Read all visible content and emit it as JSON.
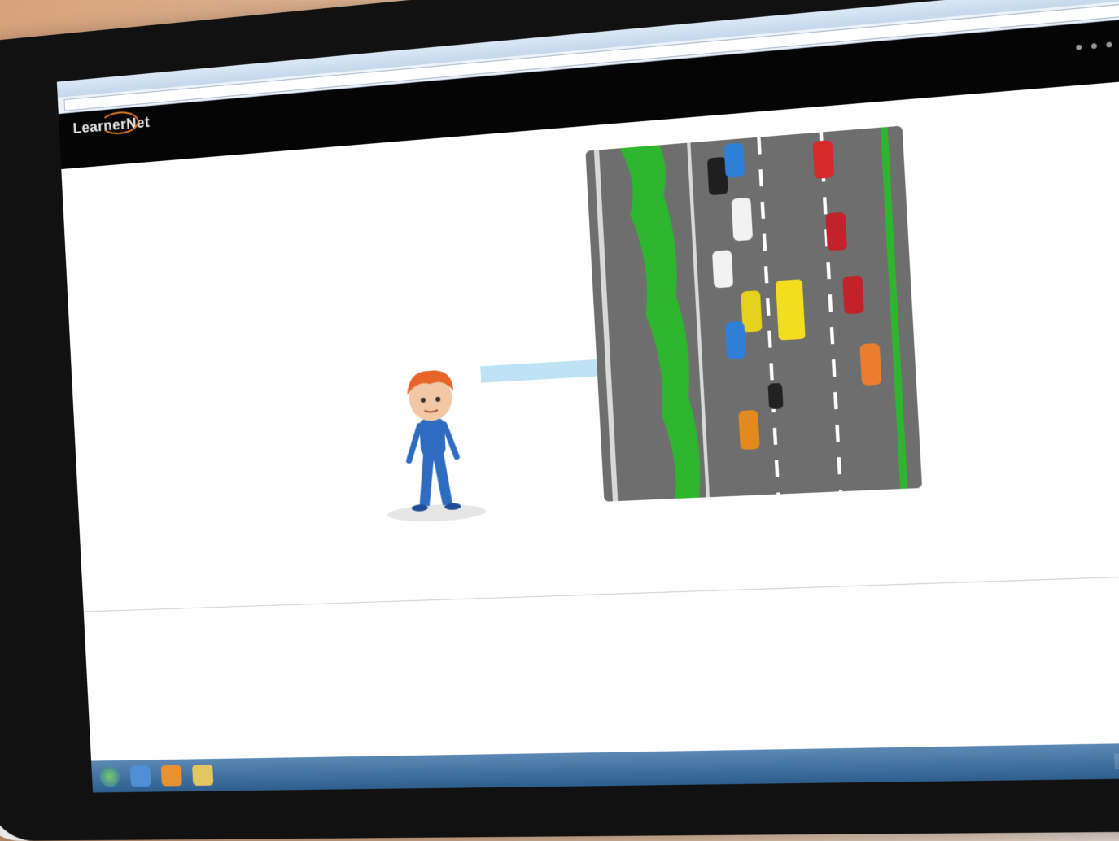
{
  "browser": {
    "window_title": "",
    "address": ""
  },
  "header": {
    "logo_text": "LearnerNet",
    "logo_subtitle": "",
    "top_link": ""
  },
  "lesson": {
    "title": "",
    "paragraphs": [
      "",
      ""
    ],
    "speech_bubble": ""
  },
  "labels": {
    "below_image": "",
    "right": "",
    "footer": ""
  },
  "colors": {
    "accent": "#e07a1f",
    "header_bg": "#050505",
    "bubble_bg": "#bfe3f5",
    "road": "#6e6e6e",
    "grass": "#2fb62f"
  },
  "taskbar": {
    "icons": [
      "windows-start-icon",
      "internet-explorer-icon",
      "firefox-icon",
      "folder-icon"
    ]
  }
}
